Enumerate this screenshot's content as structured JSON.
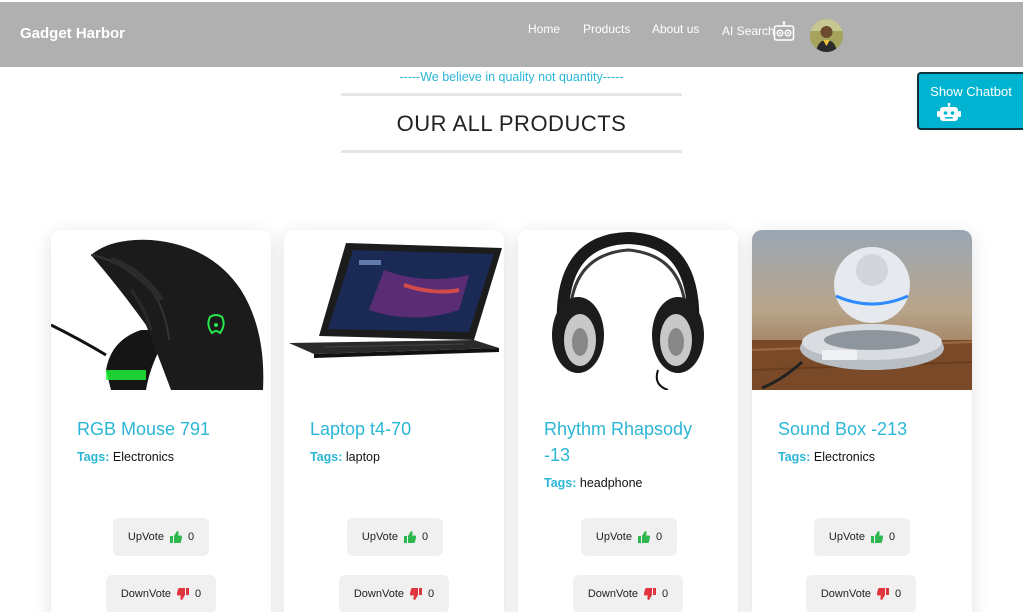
{
  "brand": "Gadget Harbor",
  "nav": {
    "home": "Home",
    "products": "Products",
    "about": "About us",
    "ai_search": "AI Search"
  },
  "tagline": "-----We believe in quality not quantity-----",
  "page_title": "OUR ALL PRODUCTS",
  "chatbot_label": "Show Chatbot",
  "tags_label": "Tags:",
  "upvote_label": "UpVote",
  "downvote_label": "DownVote",
  "products": [
    {
      "title": "RGB Mouse 791",
      "tag": "Electronics",
      "upvotes": "0",
      "downvotes": "0",
      "image": "gaming-mouse"
    },
    {
      "title": "Laptop t4-70",
      "tag": "laptop",
      "upvotes": "0",
      "downvotes": "0",
      "image": "laptop"
    },
    {
      "title": "Rhythm Rhapsody -13",
      "tag": "headphone",
      "upvotes": "0",
      "downvotes": "0",
      "image": "headphones"
    },
    {
      "title": "Sound Box -213",
      "tag": "Electronics",
      "upvotes": "0",
      "downvotes": "0",
      "image": "levitating-speaker"
    }
  ],
  "colors": {
    "nav_bg": "#b0b0b0",
    "accent": "#2bb6d6",
    "chatbot_bg": "#00b3d1",
    "thumb_up": "#2db84d",
    "thumb_down": "#e0353e"
  }
}
